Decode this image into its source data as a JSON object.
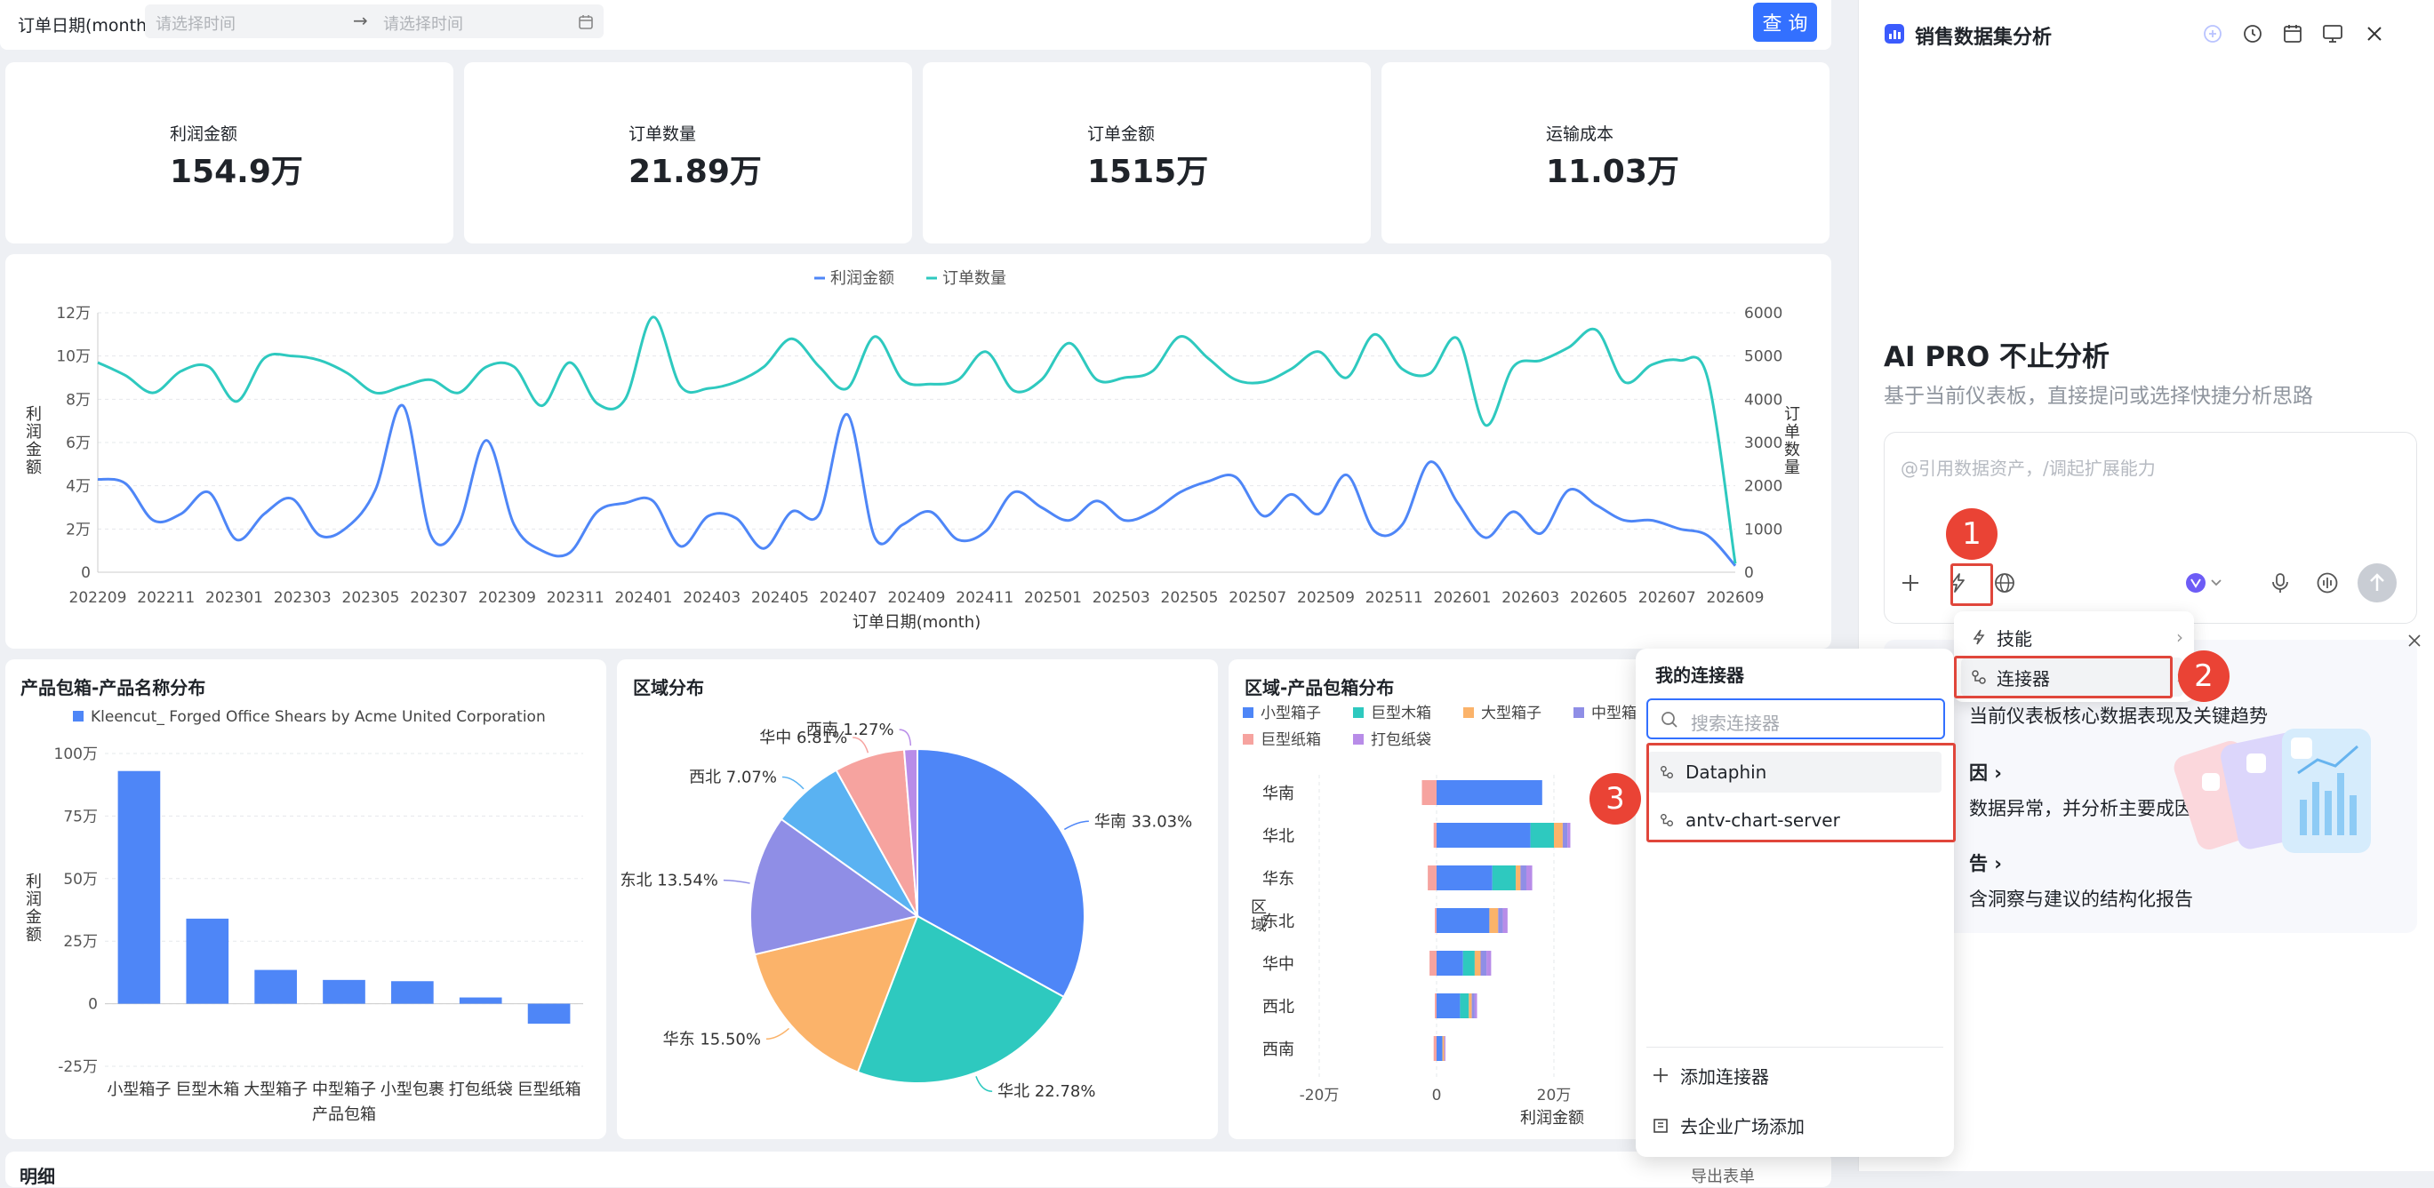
{
  "filter": {
    "label": "订单日期(month)",
    "start_placeholder": "请选择时间",
    "arrow": "→",
    "end_placeholder": "请选择时间",
    "query_button": "查 询"
  },
  "kpis": [
    {
      "label": "利润金额",
      "value": "154.9万"
    },
    {
      "label": "订单数量",
      "value": "21.89万"
    },
    {
      "label": "订单金额",
      "value": "1515万"
    },
    {
      "label": "运输成本",
      "value": "11.03万"
    }
  ],
  "colors": {
    "blue": "#4e86f7",
    "teal": "#2ec9bf",
    "orange": "#fbb36a",
    "purple": "#8f8ee6",
    "sky": "#5ab2f2",
    "pink": "#f6a39f",
    "violet": "#b88ce8",
    "red": "#e0463b",
    "accent": "#3370ff"
  },
  "chart_data": [
    {
      "type": "line",
      "legend": [
        "利润金额",
        "订单数量"
      ],
      "xlabel": "订单日期(month)",
      "ylabel_left": "利润金额",
      "ylabel_right": "订单数量",
      "yticks_left": [
        "0",
        "2万",
        "4万",
        "6万",
        "8万",
        "10万",
        "12万"
      ],
      "yticks_right": [
        "0",
        "1000",
        "2000",
        "3000",
        "4000",
        "5000",
        "6000"
      ],
      "ylim_left": [
        0,
        120000
      ],
      "ylim_right": [
        0,
        6000
      ],
      "xtick_labels": [
        "202209",
        "202211",
        "202301",
        "202303",
        "202305",
        "202307",
        "202309",
        "202311",
        "202401",
        "202403",
        "202405",
        "202407",
        "202409",
        "202411",
        "202501",
        "202503",
        "202505",
        "202507",
        "202509",
        "202511",
        "202601",
        "202603",
        "202605",
        "202607",
        "202609"
      ],
      "series": [
        {
          "name": "利润金额",
          "axis": "left",
          "values": [
            43000,
            41000,
            24000,
            27000,
            37000,
            15000,
            27000,
            34000,
            17000,
            21000,
            38000,
            77000,
            17000,
            22000,
            61000,
            22000,
            10000,
            9000,
            28000,
            32000,
            33000,
            12000,
            26000,
            25000,
            11000,
            28000,
            27000,
            73000,
            16000,
            22000,
            28000,
            15000,
            19000,
            37000,
            30000,
            24000,
            33000,
            24000,
            28000,
            37000,
            42000,
            44000,
            26000,
            36000,
            27000,
            45000,
            19000,
            22000,
            51000,
            32000,
            16000,
            28000,
            18000,
            38000,
            31000,
            24000,
            24000,
            20000,
            17000,
            3000
          ]
        },
        {
          "name": "订单数量",
          "axis": "right",
          "values": [
            4850,
            4550,
            4150,
            4650,
            4750,
            3950,
            4950,
            5000,
            4900,
            4600,
            4150,
            4300,
            4450,
            4150,
            4750,
            4750,
            3850,
            4850,
            3900,
            4000,
            5900,
            4300,
            4250,
            4400,
            4750,
            5400,
            4750,
            4250,
            5450,
            4450,
            4350,
            4450,
            5100,
            4200,
            4450,
            5300,
            4450,
            4500,
            4650,
            5450,
            4950,
            4450,
            4400,
            4700,
            5100,
            4500,
            5500,
            4700,
            4600,
            5400,
            3400,
            4750,
            4900,
            5200,
            5600,
            4400,
            4800,
            4900,
            4500,
            200
          ]
        }
      ]
    },
    {
      "type": "bar",
      "title": "产品包箱-产品名称分布",
      "legend": [
        "Kleencut_ Forged Office Shears by Acme United Corporation"
      ],
      "categories": [
        "小型箱子",
        "巨型木箱",
        "大型箱子",
        "中型箱子",
        "小型包裹",
        "打包纸袋",
        "巨型纸箱"
      ],
      "values": [
        930000,
        340000,
        135000,
        95000,
        90000,
        25000,
        -80000
      ],
      "yticks": [
        "-25万",
        "0",
        "25万",
        "50万",
        "75万",
        "100万"
      ],
      "ylim": [
        -250000,
        1000000
      ],
      "xlabel": "产品包箱",
      "ylabel": "利润金额"
    },
    {
      "type": "pie",
      "title": "区域分布",
      "slices": [
        {
          "name": "华南",
          "value": 33.03,
          "label": "华南 33.03%"
        },
        {
          "name": "华北",
          "value": 22.78,
          "label": "华北 22.78%"
        },
        {
          "name": "华东",
          "value": 15.5,
          "label": "华东 15.50%"
        },
        {
          "name": "东北",
          "value": 13.54,
          "label": "东北 13.54%"
        },
        {
          "name": "西北",
          "value": 7.07,
          "label": "西北 7.07%"
        },
        {
          "name": "华中",
          "value": 6.81,
          "label": "华中 6.81%"
        },
        {
          "name": "西南",
          "value": 1.27,
          "label": "西南 1.27%"
        }
      ]
    },
    {
      "type": "bar",
      "orientation": "horizontal",
      "stacked": true,
      "title": "区域-产品包箱分布",
      "legend": [
        "小型箱子",
        "巨型木箱",
        "大型箱子",
        "中型箱子",
        "巨型纸箱",
        "打包纸袋"
      ],
      "categories": [
        "华南",
        "华北",
        "华东",
        "东北",
        "华中",
        "西北",
        "西南"
      ],
      "series": [
        {
          "name": "巨型纸箱",
          "values": [
            -25000,
            -5000,
            -15000,
            -3000,
            -12000,
            -3000,
            -5000
          ]
        },
        {
          "name": "小型箱子",
          "values": [
            180000,
            160000,
            95000,
            90000,
            45000,
            40000,
            10000
          ]
        },
        {
          "name": "巨型木箱",
          "values": [
            0,
            40000,
            40000,
            0,
            20000,
            15000,
            0
          ]
        },
        {
          "name": "大型箱子",
          "values": [
            0,
            15000,
            8000,
            15000,
            10000,
            5000,
            3000
          ]
        },
        {
          "name": "中型箱子",
          "values": [
            0,
            8000,
            10000,
            8000,
            10000,
            5000,
            0
          ]
        },
        {
          "name": "打包纸袋",
          "values": [
            0,
            5000,
            10000,
            8000,
            8000,
            4000,
            2000
          ]
        }
      ],
      "xticks": [
        "-20万",
        "0",
        "20万"
      ],
      "xlabel": "利润金额",
      "ylabel": "区域"
    }
  ],
  "connector_popup": {
    "title": "我的连接器",
    "search_placeholder": "搜索连接器",
    "items": [
      "Dataphin",
      "antv-chart-server"
    ],
    "add": "添加连接器",
    "enterprise": "去企业广场添加"
  },
  "tool_menu": {
    "items": [
      "技能",
      "连接器"
    ]
  },
  "ai_panel": {
    "title": "销售数据集分析",
    "heading": "AI PRO 不止分析",
    "subheading": "基于当前仪表板，直接提问或选择快捷分析思路",
    "input_placeholder": "@引用数据资产，/调起扩展能力",
    "suggestions": [
      {
        "title": "",
        "desc": "当前仪表板核心数据表现及关键趋势"
      },
      {
        "title": "因",
        "desc": "数据异常，并分析主要成因"
      },
      {
        "title": "告",
        "desc": "含洞察与建议的结构化报告"
      }
    ]
  },
  "badges": [
    "1",
    "2",
    "3"
  ],
  "bottom_hints": [
    "明细",
    "导出表单"
  ]
}
